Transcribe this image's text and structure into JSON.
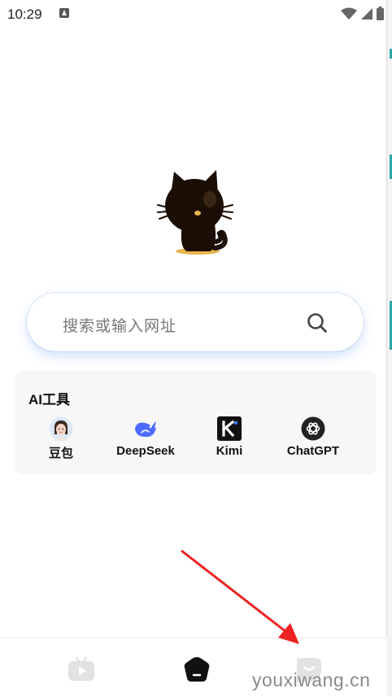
{
  "status_bar": {
    "time": "10:29",
    "icons": [
      "app-notification-icon",
      "wifi-icon",
      "signal-icon",
      "battery-icon"
    ]
  },
  "search": {
    "placeholder": "搜索或输入网址",
    "icon": "search-icon"
  },
  "ai_tools": {
    "title": "AI工具",
    "items": [
      {
        "label": "豆包",
        "icon": "doubao-icon"
      },
      {
        "label": "DeepSeek",
        "icon": "deepseek-icon",
        "color": "#4d6bfe"
      },
      {
        "label": "Kimi",
        "icon": "kimi-icon",
        "color": "#111111"
      },
      {
        "label": "ChatGPT",
        "icon": "chatgpt-icon",
        "color": "#222222"
      }
    ]
  },
  "bottom_nav": {
    "items": [
      {
        "name": "video-tab",
        "icon": "tv-icon",
        "active": false
      },
      {
        "name": "home-tab",
        "icon": "home-icon",
        "active": true
      },
      {
        "name": "chat-tab",
        "icon": "chat-bubble-icon",
        "active": false
      }
    ]
  },
  "colors": {
    "accent_shadow": "#5a96eb",
    "annotation_arrow": "#ee2222",
    "inactive_nav": "#e2e2e2"
  },
  "watermark": "youxiwang.cn"
}
